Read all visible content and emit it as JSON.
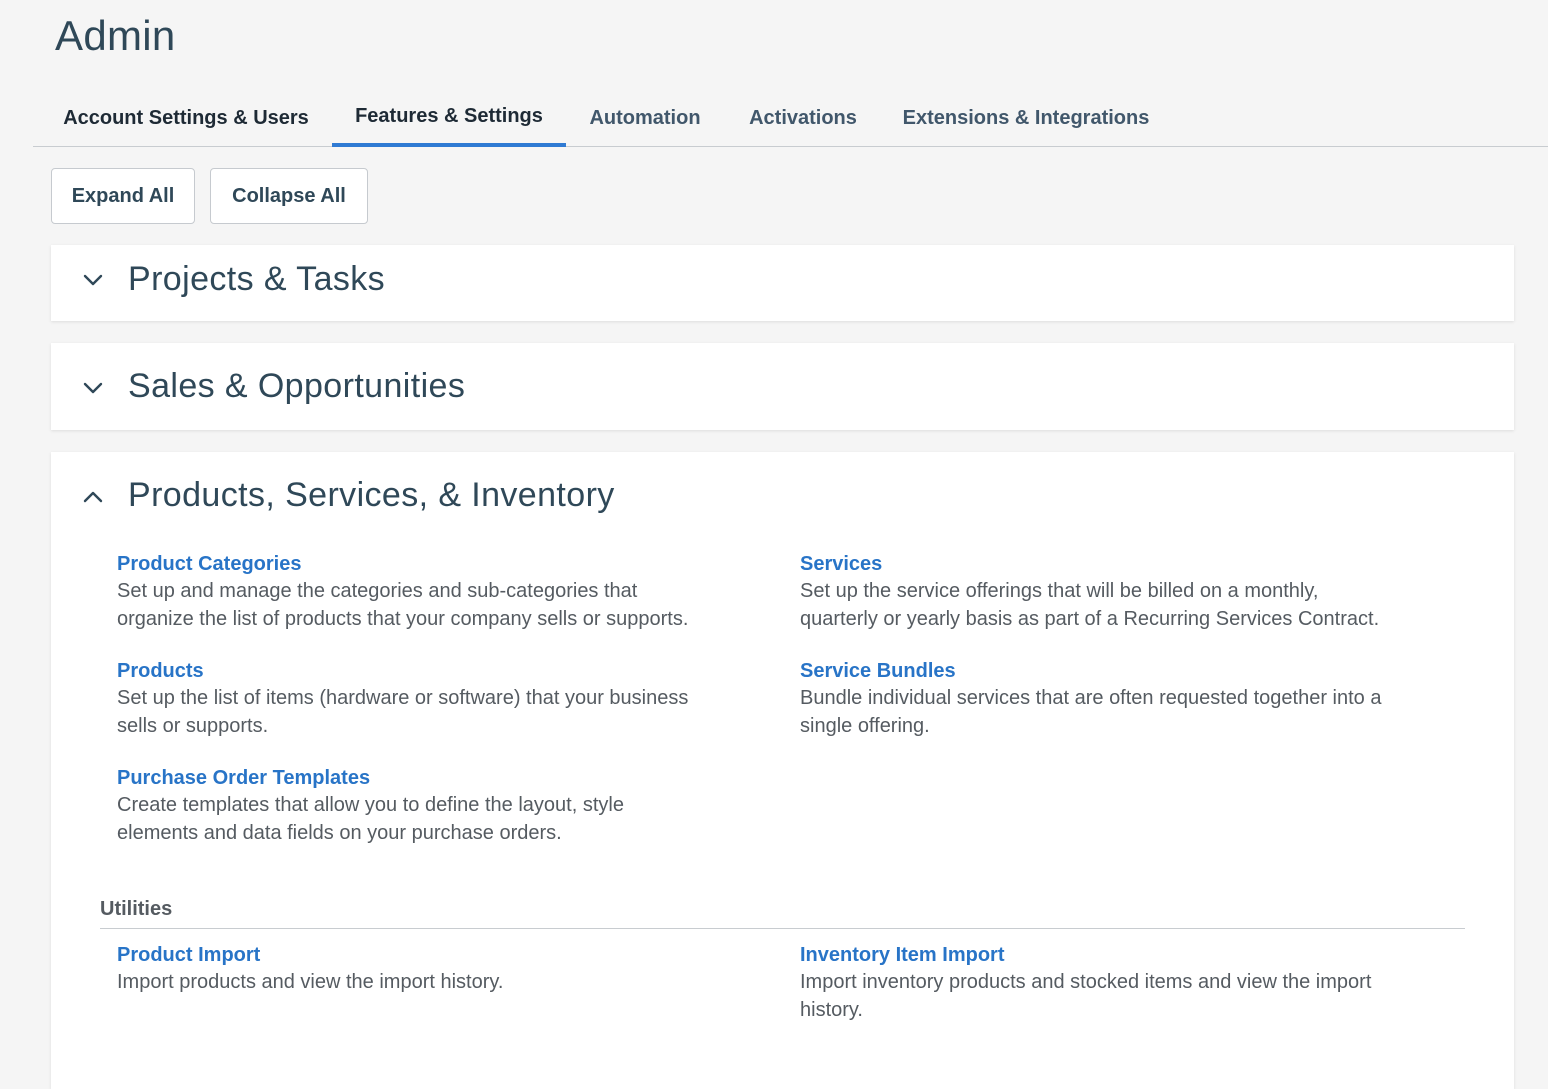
{
  "page": {
    "title": "Admin"
  },
  "tabs": [
    {
      "label": "Account Settings & Users"
    },
    {
      "label": "Features & Settings",
      "active": true
    },
    {
      "label": "Automation"
    },
    {
      "label": "Activations"
    },
    {
      "label": "Extensions & Integrations"
    }
  ],
  "toolbar": {
    "expand_label": "Expand All",
    "collapse_label": "Collapse All"
  },
  "sections": [
    {
      "title": "Projects & Tasks",
      "expanded": false,
      "chevron": "chevron-down-icon"
    },
    {
      "title": "Sales & Opportunities",
      "expanded": false,
      "chevron": "chevron-down-icon"
    },
    {
      "title": "Products, Services, & Inventory",
      "expanded": true,
      "chevron": "chevron-up-icon",
      "items": [
        {
          "title": "Product Categories",
          "desc1": "Set up and manage the categories and sub-categories that",
          "desc2": "organize the list of products that your company sells or supports."
        },
        {
          "title": "Services",
          "desc1": "Set up the service offerings that will be billed on a monthly,",
          "desc2": "quarterly or yearly basis as part of a Recurring Services Contract."
        },
        {
          "title": "Products",
          "desc1": "Set up the list of items (hardware or software) that your business",
          "desc2": "sells or supports."
        },
        {
          "title": "Service Bundles",
          "desc1": "Bundle individual services that are often requested together into a",
          "desc2": "single offering."
        },
        {
          "title": "Purchase Order Templates",
          "desc1": "Create templates that allow you to define the layout, style",
          "desc2": "elements and data fields on your purchase orders."
        }
      ],
      "utilities": {
        "label": "Utilities",
        "items": [
          {
            "title": "Product Import",
            "desc1": "Import products and view the import history."
          },
          {
            "title": "Inventory Item Import",
            "desc1": "Import inventory products and stocked items and view the import",
            "desc2": "history."
          }
        ]
      }
    }
  ],
  "colors": {
    "accent": "#2f7ad3",
    "link": "#2874c7",
    "heading": "#2f4858",
    "text": "#555b61"
  }
}
